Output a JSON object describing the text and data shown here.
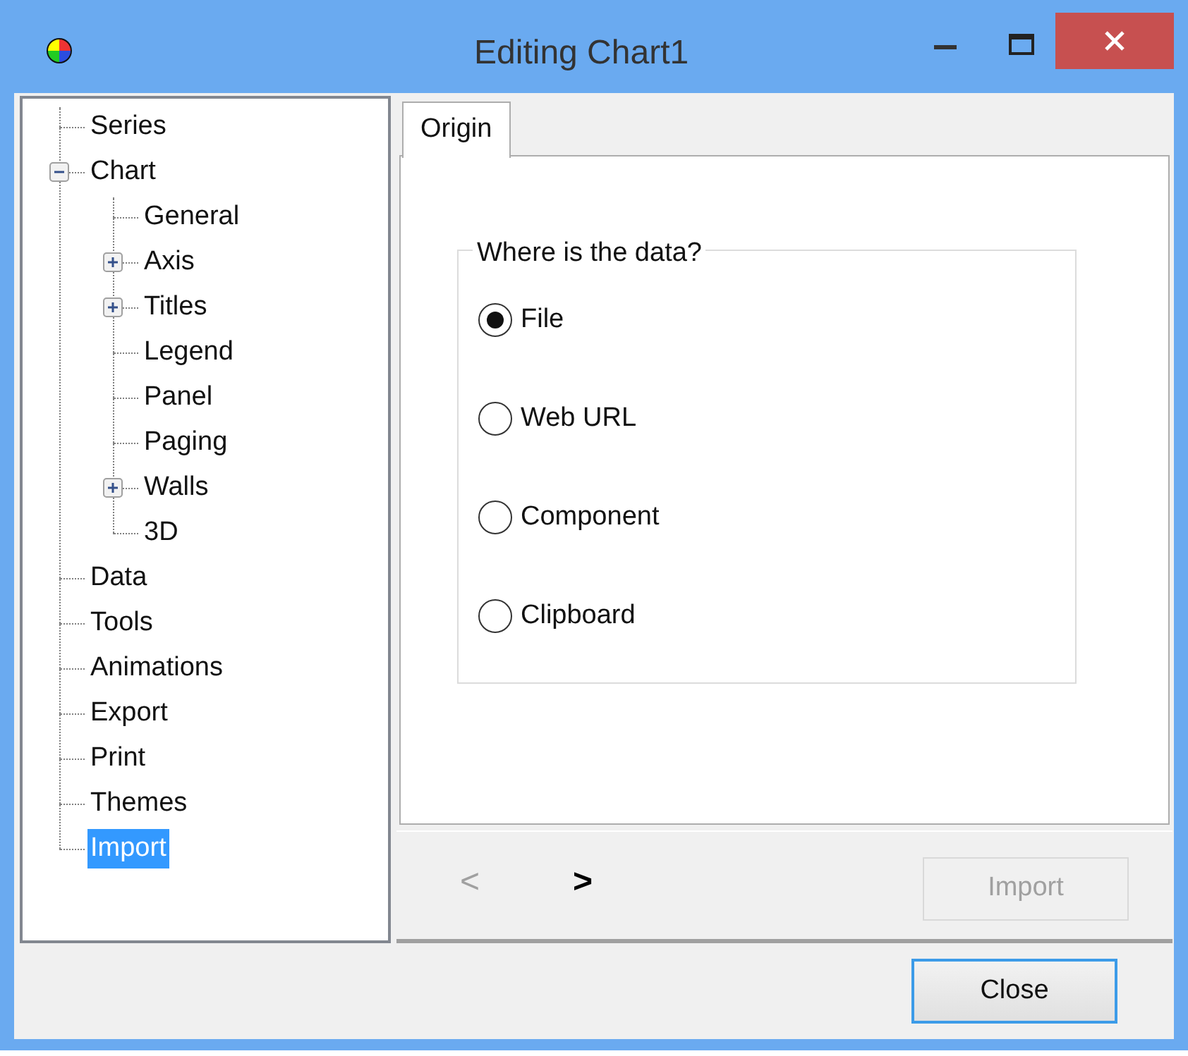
{
  "window": {
    "title": "Editing Chart1"
  },
  "tree": [
    {
      "label": "Series",
      "selected": false
    },
    {
      "label": "Chart",
      "selected": false,
      "expanded": true,
      "children": [
        {
          "label": "General",
          "selected": false
        },
        {
          "label": "Axis",
          "selected": false,
          "expanded": false
        },
        {
          "label": "Titles",
          "selected": false,
          "expanded": false
        },
        {
          "label": "Legend",
          "selected": false
        },
        {
          "label": "Panel",
          "selected": false
        },
        {
          "label": "Paging",
          "selected": false
        },
        {
          "label": "Walls",
          "selected": false,
          "expanded": false
        },
        {
          "label": "3D",
          "selected": false
        }
      ]
    },
    {
      "label": "Data",
      "selected": false
    },
    {
      "label": "Tools",
      "selected": false
    },
    {
      "label": "Animations",
      "selected": false
    },
    {
      "label": "Export",
      "selected": false
    },
    {
      "label": "Print",
      "selected": false
    },
    {
      "label": "Themes",
      "selected": false
    },
    {
      "label": "Import",
      "selected": true
    }
  ],
  "tabs": [
    {
      "label": "Origin",
      "selected": true
    }
  ],
  "group": {
    "title": "Where is the data?",
    "options": [
      {
        "label": "File",
        "selected": true
      },
      {
        "label": "Web URL",
        "selected": false
      },
      {
        "label": "Component",
        "selected": false
      },
      {
        "label": "Clipboard",
        "selected": false
      }
    ]
  },
  "nav": {
    "back": {
      "label": "<",
      "disabled": true
    },
    "next": {
      "label": ">",
      "disabled": false
    },
    "import": {
      "label": "Import",
      "disabled": true
    }
  },
  "buttons": [
    {
      "label": "Close"
    }
  ]
}
